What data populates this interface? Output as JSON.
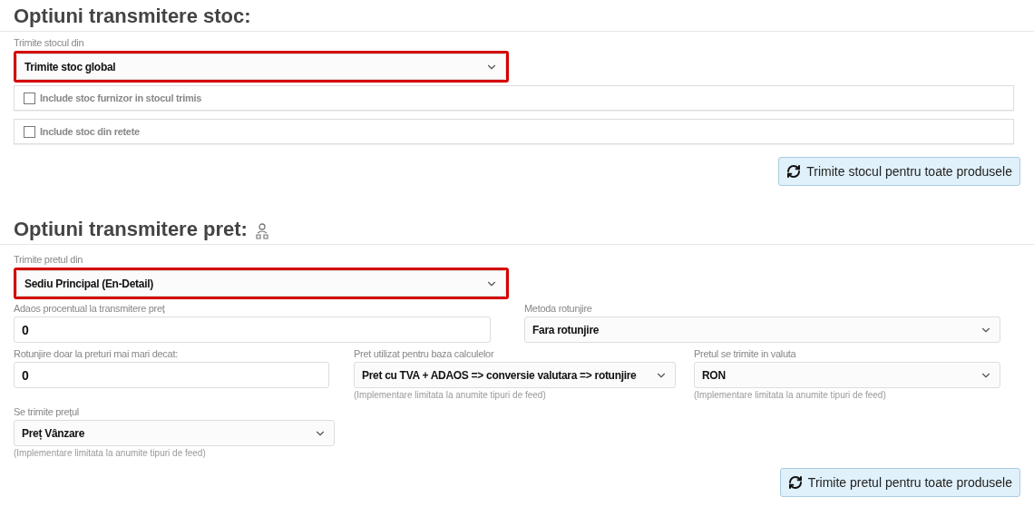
{
  "stock_section": {
    "title": "Optiuni transmitere stoc:",
    "source_select": {
      "label": "Trimite stocul din",
      "value": "Trimite stoc global",
      "highlighted": true
    },
    "checkboxes": [
      {
        "label": "Include stoc furnizor in stocul trimis",
        "checked": false
      },
      {
        "label": "Include stoc din retete",
        "checked": false
      }
    ],
    "button": "Trimite stocul pentru toate produsele"
  },
  "price_section": {
    "title": "Optiuni transmitere pret:",
    "source_select": {
      "label": "Trimite pretul din",
      "value": "Sediu Principal (En-Detail)",
      "highlighted": true
    },
    "rows": [
      [
        {
          "kind": "input",
          "label": "Adaos procentual la transmitere preț",
          "value": "0"
        },
        {
          "kind": "select",
          "label": "Metoda rotunjire",
          "value": "Fara rotunjire"
        }
      ],
      [
        {
          "kind": "input",
          "label": "Rotunjire doar la preturi mai mari decat:",
          "value": "0"
        },
        {
          "kind": "select",
          "label": "Pret utilizat pentru baza calculelor",
          "value": "Pret cu TVA + ADAOS => conversie valutara => rotunjire",
          "hint": "(Implementare limitata la anumite tipuri de feed)"
        },
        {
          "kind": "select",
          "label": "Pretul se trimite in valuta",
          "value": "RON",
          "hint": "(Implementare limitata la anumite tipuri de feed)"
        }
      ],
      [
        {
          "kind": "select",
          "label": "Se trimite prețul",
          "value": "Preț Vânzare",
          "hint": "(Implementare limitata la anumite tipuri de feed)"
        }
      ]
    ],
    "button": "Trimite pretul pentru toate produsele"
  }
}
